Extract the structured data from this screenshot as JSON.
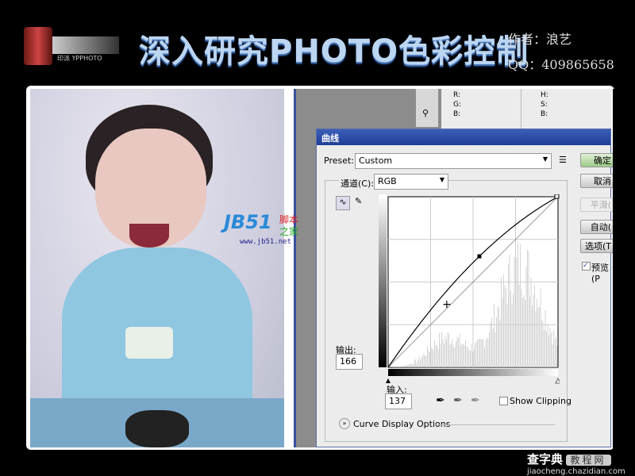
{
  "header": {
    "logo_text": "印派 YPPHOTO",
    "title": "深入研究PHOTO色彩控制",
    "author": "作者：浪艺",
    "qq": "QQ：409865658"
  },
  "info_panel": {
    "rgb": [
      "R:",
      "G:",
      "B:"
    ],
    "hsb": [
      "H:",
      "S:",
      "B:"
    ]
  },
  "dialog": {
    "title": "曲线",
    "preset_label": "Preset:",
    "preset_value": "Custom",
    "channel_label": "通道(C):",
    "channel_value": "RGB",
    "output_label": "输出:",
    "output_value": "166",
    "input_label": "输入:",
    "input_value": "137",
    "show_clipping": "Show Clipping",
    "show_clipping_checked": false,
    "curve_display_options": "Curve Display Options",
    "buttons": {
      "ok": "确定",
      "cancel": "取消",
      "smooth": "平滑(",
      "auto": "自动(",
      "options": "选项(T"
    },
    "preview": "预览(P",
    "preview_checked": true,
    "curve_point": {
      "input": 137,
      "output": 166
    }
  },
  "watermark_jb51": {
    "logo": "JB51",
    "cn1": "脚本",
    "cn2": "之家",
    "url": "www.jb51.net"
  },
  "watermark_chazidian": {
    "cn": "查字典",
    "badge": "教程网",
    "url": "jiaocheng.chazidian.com"
  }
}
